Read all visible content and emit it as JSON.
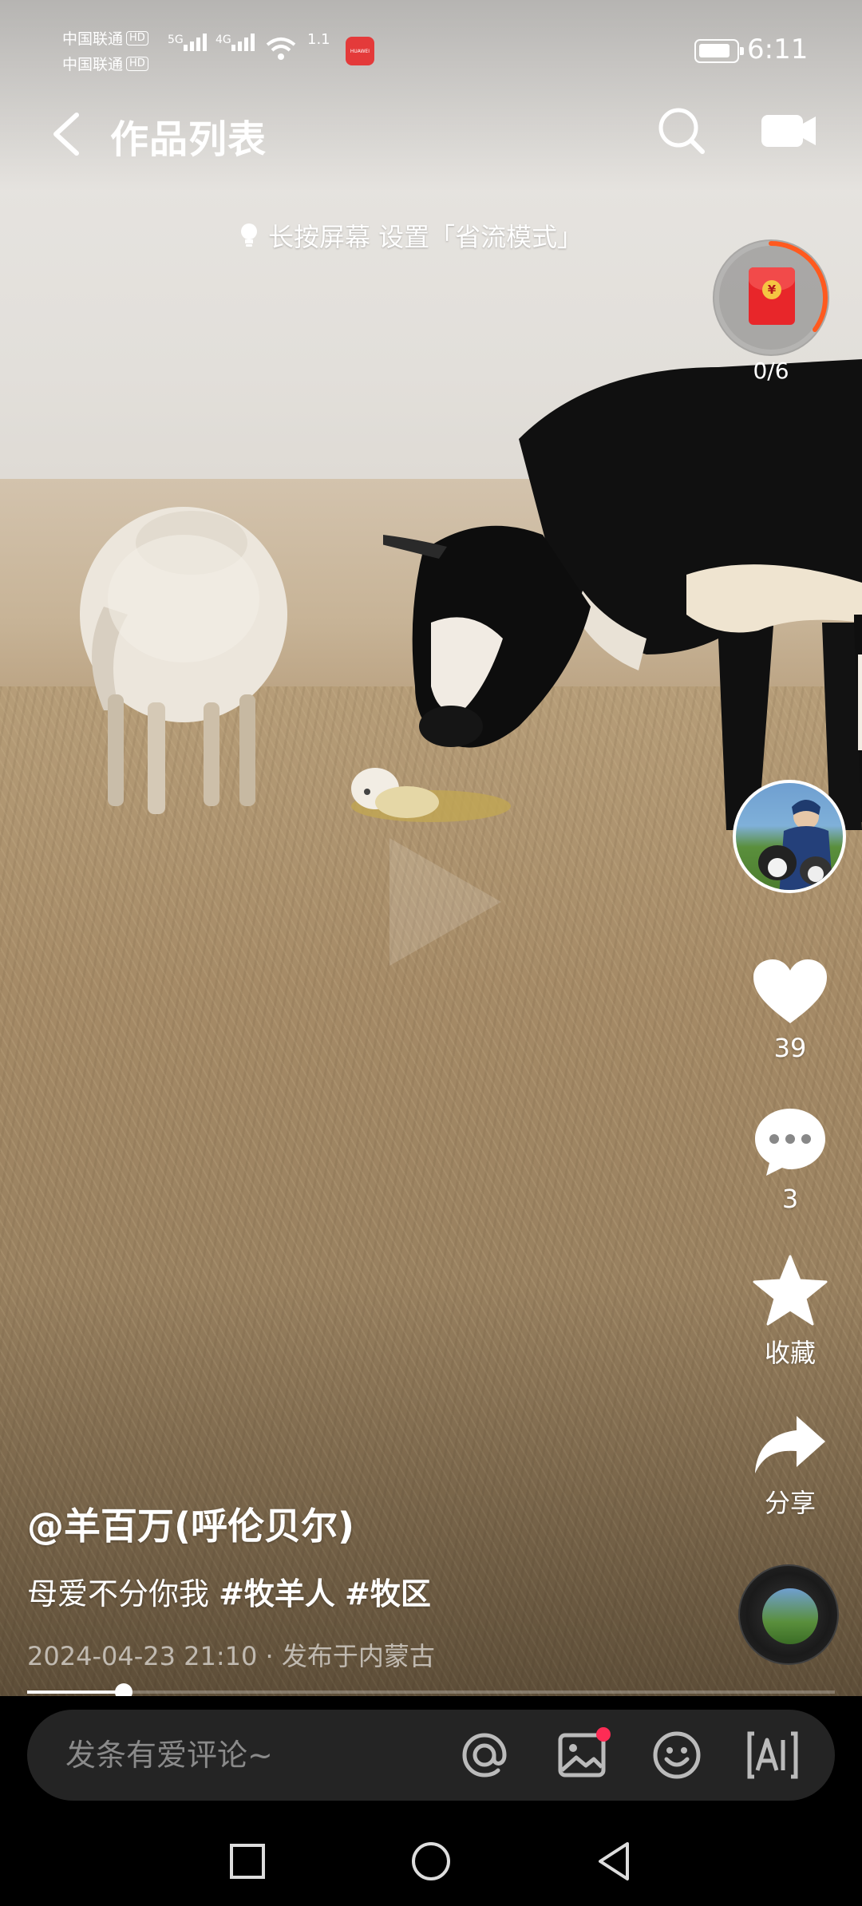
{
  "status_bar": {
    "carrier1": "中国联通",
    "carrier2": "中国联通",
    "hd": "HD",
    "net1": "5G",
    "net2": "4G",
    "speed_value": "1.1",
    "huawei_badge": "HUAWEI",
    "time": "6:11"
  },
  "header": {
    "title": "作品列表",
    "back_icon": "chevron-left-icon",
    "search_icon": "search-icon",
    "camera_icon": "video-camera-icon"
  },
  "tip": {
    "text": "长按屏幕 设置「省流模式」"
  },
  "red_packet": {
    "coin_symbol": "¥",
    "count": "0/6",
    "progress": 0.35,
    "accent": "#ff5a1f"
  },
  "actions": {
    "likes": "39",
    "comments": "3",
    "favorite_label": "收藏",
    "share_label": "分享"
  },
  "video": {
    "author": "@羊百万(呼伦贝尔)",
    "desc_text": "母爱不分你我 ",
    "tags": [
      "#牧羊人",
      "#牧区"
    ],
    "meta": "2024-04-23 21:10 · 发布于内蒙古",
    "progress": 0.12
  },
  "comment_bar": {
    "placeholder": "发条有爱评论~",
    "icons": [
      "at-icon",
      "image-icon",
      "emoji-icon",
      "ai-text-icon"
    ]
  },
  "colors": {
    "accent_red": "#fe2c55",
    "packet_red": "#e8262a"
  }
}
